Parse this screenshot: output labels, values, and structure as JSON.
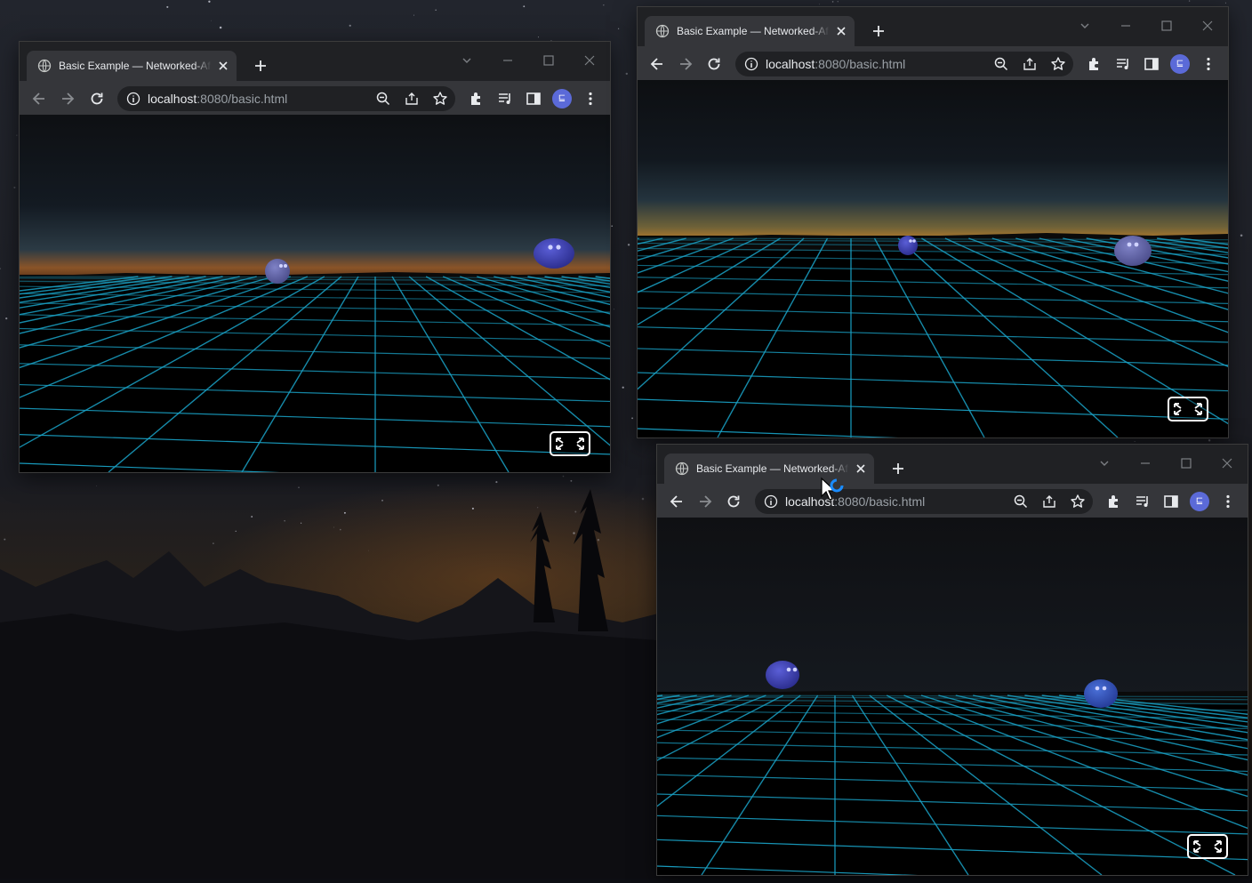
{
  "windows": [
    {
      "tab_title": "Basic Example — Networked-Aframe",
      "url_host": "localhost",
      "url_rest": ":8080/basic.html",
      "avatar_letter": "⊑"
    },
    {
      "tab_title": "Basic Example — Networked-Aframe",
      "url_host": "localhost",
      "url_rest": ":8080/basic.html",
      "avatar_letter": "⊑"
    },
    {
      "tab_title": "Basic Example — Networked-Aframe",
      "url_host": "localhost",
      "url_rest": ":8080/basic.html",
      "avatar_letter": "⊑"
    }
  ],
  "icons": {
    "favicon": "globe-icon",
    "back": "arrow-left-icon",
    "forward": "arrow-right-icon",
    "reload": "reload-icon",
    "info": "info-icon",
    "zoom": "zoom-out-icon",
    "share": "share-icon",
    "bookmark": "star-icon",
    "extensions": "puzzle-icon",
    "media": "media-queue-icon",
    "sidepanel": "side-panel-icon",
    "menu": "kebab-menu-icon",
    "fullscreen": "enter-vr-fullscreen-icon"
  },
  "colors": {
    "grid": "#1aa3c7",
    "avatar_blob": "#3b3fb8",
    "browser_chrome": "#202124",
    "toolbar": "#35363a",
    "profile": "#5b6ad8"
  }
}
